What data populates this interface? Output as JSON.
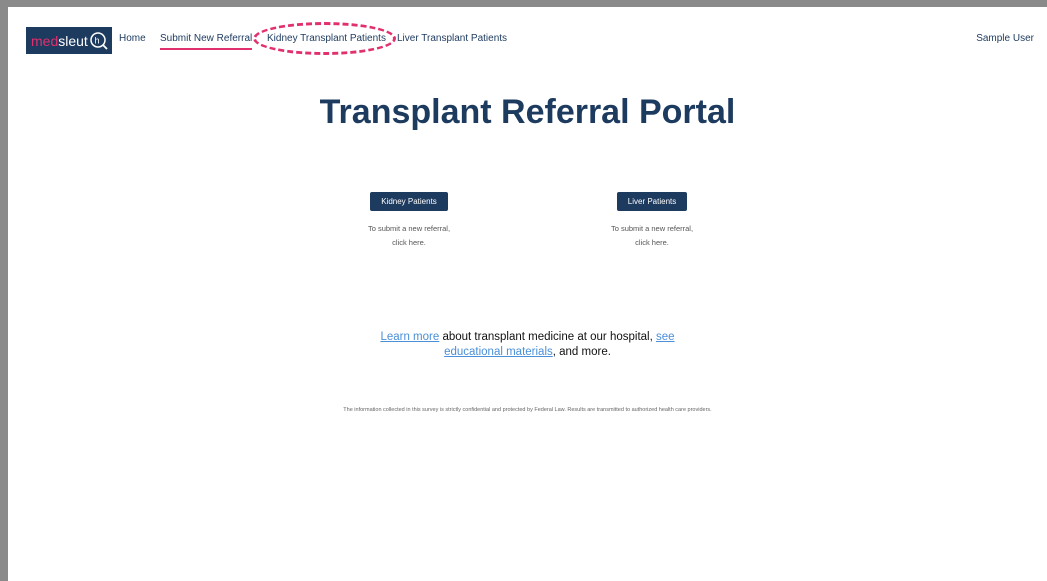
{
  "nav": {
    "logo": {
      "part1": "med",
      "part2": "sleut"
    },
    "links": [
      "Home",
      "Submit New Referral",
      "Kidney Transplant Patients",
      "Liver Transplant Patients"
    ],
    "active_index": 1,
    "user": "Sample User"
  },
  "main": {
    "title": "Transplant Referral Portal",
    "kidney": {
      "button": "Kidney Patients",
      "line1": "To submit a new referral,",
      "line2": "click here."
    },
    "liver": {
      "button": "Liver Patients",
      "line1": "To submit a new referral,",
      "line2": "click here."
    },
    "learn": {
      "link1": "Learn more",
      "text1": " about transplant medicine at our hospital, ",
      "link2a": "see",
      "link2b": "educational materials",
      "text2": ", and more."
    },
    "footer": "The information collected in this survey is strictly confidential and protected by Federal Law. Results are transmitted to authorized health care providers."
  },
  "colors": {
    "brand": "#1d3a5f",
    "accent": "#e0306e",
    "link": "#4a8fd8"
  },
  "icons": {
    "logo": "magnifier-h-icon"
  }
}
